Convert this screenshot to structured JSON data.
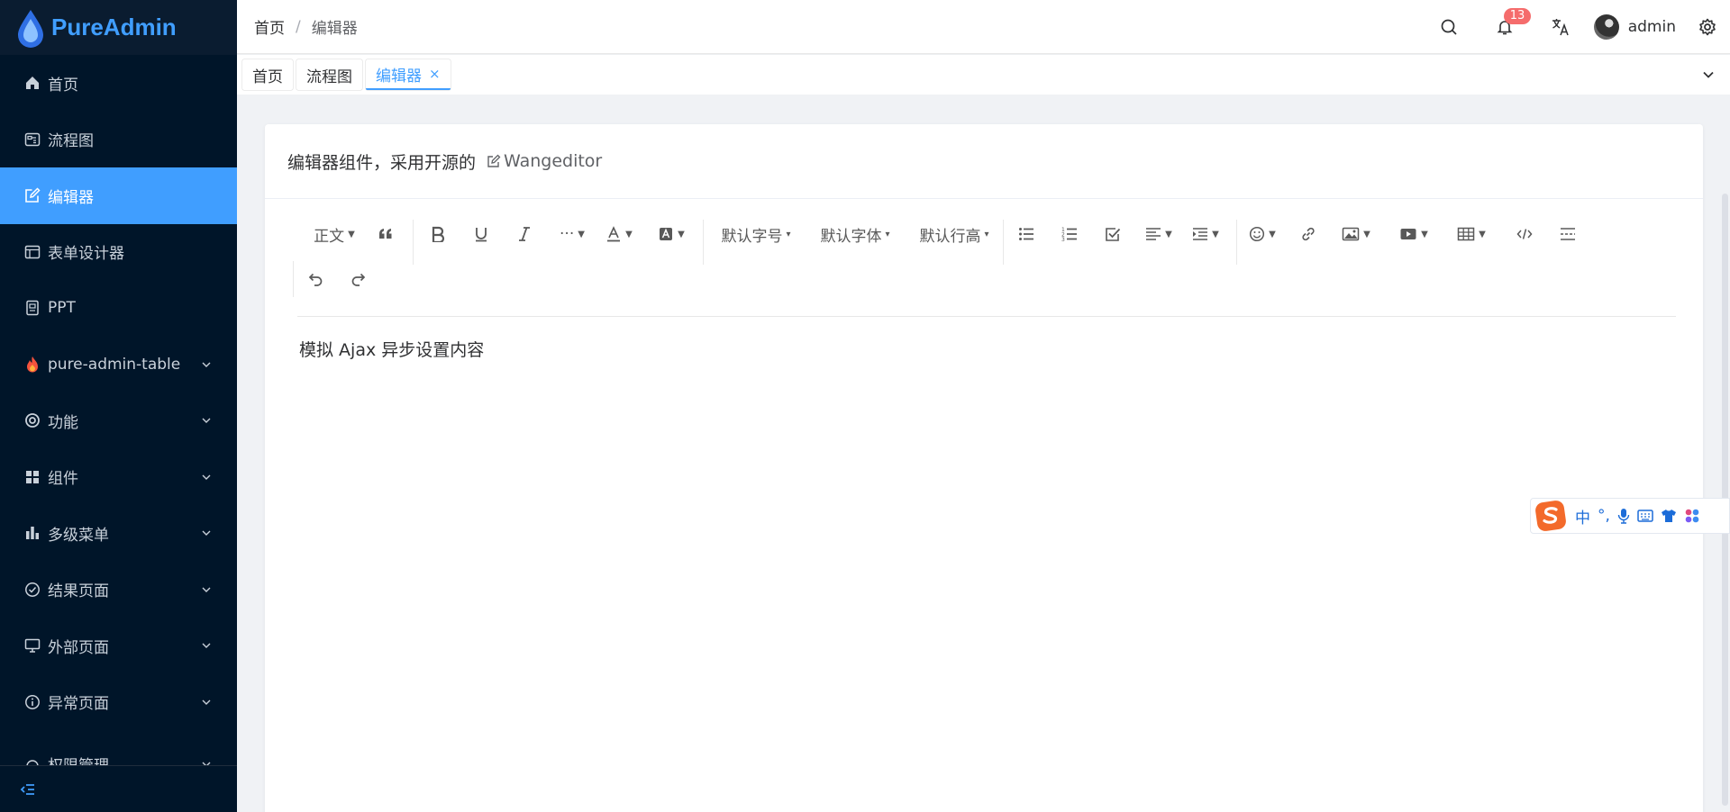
{
  "app": {
    "name": "PureAdmin"
  },
  "sidebar": {
    "items": [
      {
        "label": "首页",
        "icon": "home-icon",
        "active": false,
        "expandable": false
      },
      {
        "label": "流程图",
        "icon": "flowchart-icon",
        "active": false,
        "expandable": false
      },
      {
        "label": "编辑器",
        "icon": "edit-icon",
        "active": true,
        "expandable": false
      },
      {
        "label": "表单设计器",
        "icon": "form-icon",
        "active": false,
        "expandable": false
      },
      {
        "label": "PPT",
        "icon": "ppt-icon",
        "active": false,
        "expandable": false
      },
      {
        "label": "pure-admin-table",
        "icon": "fire-icon",
        "active": false,
        "expandable": true
      },
      {
        "label": "功能",
        "icon": "function-icon",
        "active": false,
        "expandable": true
      },
      {
        "label": "组件",
        "icon": "components-icon",
        "active": false,
        "expandable": true
      },
      {
        "label": "多级菜单",
        "icon": "bar-chart-icon",
        "active": false,
        "expandable": true
      },
      {
        "label": "结果页面",
        "icon": "check-circle-icon",
        "active": false,
        "expandable": true
      },
      {
        "label": "外部页面",
        "icon": "monitor-icon",
        "active": false,
        "expandable": true
      },
      {
        "label": "异常页面",
        "icon": "info-circle-icon",
        "active": false,
        "expandable": true
      },
      {
        "label": "权限管理",
        "icon": "permission-icon",
        "active": false,
        "expandable": true
      }
    ]
  },
  "header": {
    "breadcrumb": [
      "首页",
      "编辑器"
    ],
    "notification_count": "13",
    "username": "admin"
  },
  "tabs": [
    {
      "label": "首页",
      "active": false
    },
    {
      "label": "流程图",
      "active": false
    },
    {
      "label": "编辑器",
      "active": true,
      "closable": true,
      "close_glyph": "×"
    }
  ],
  "card": {
    "title": "编辑器组件，采用开源的",
    "link_label": "Wangeditor"
  },
  "toolbar": {
    "paragraph": "正文",
    "font_size": "默认字号",
    "font_family": "默认字体",
    "line_height": "默认行高",
    "more": "···"
  },
  "editor": {
    "content": "模拟 Ajax 异步设置内容"
  },
  "ime": {
    "lang": "中",
    "punct": "°,"
  },
  "colors": {
    "accent": "#409eff",
    "sidebar_bg": "#001529",
    "badge": "#f56c6c"
  }
}
